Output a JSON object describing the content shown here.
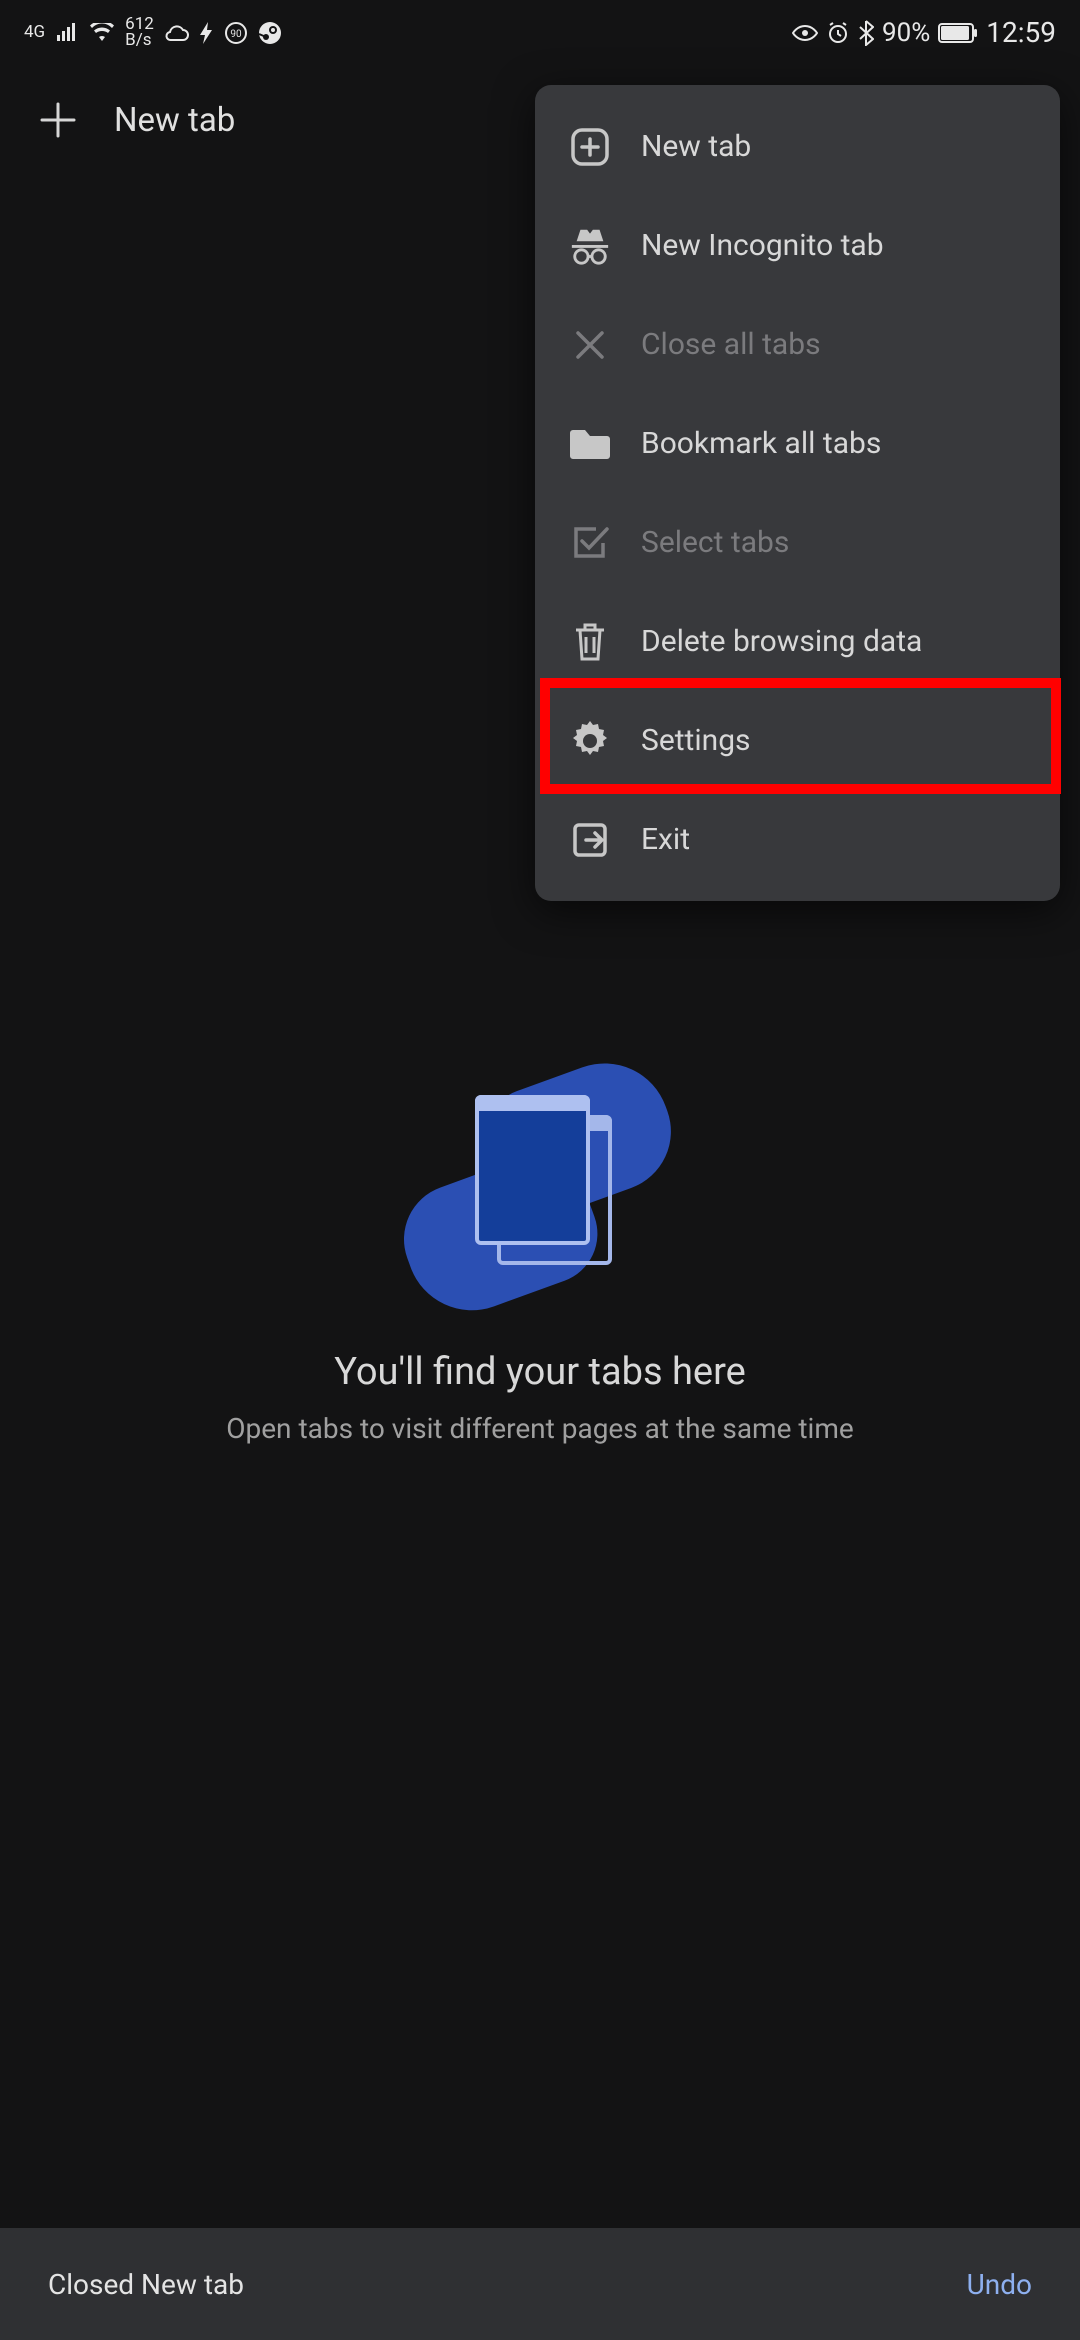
{
  "status_bar": {
    "network_label": "4G",
    "rate_value": "612",
    "rate_unit": "B/s",
    "battery_percent": "90%",
    "time": "12:59"
  },
  "toolbar": {
    "title": "New tab"
  },
  "menu": {
    "items": [
      {
        "label": "New tab",
        "icon": "plus-box",
        "enabled": true
      },
      {
        "label": "New Incognito tab",
        "icon": "incognito",
        "enabled": true
      },
      {
        "label": "Close all tabs",
        "icon": "close",
        "enabled": false
      },
      {
        "label": "Bookmark all tabs",
        "icon": "folder",
        "enabled": true
      },
      {
        "label": "Select tabs",
        "icon": "check-square",
        "enabled": false
      },
      {
        "label": "Delete browsing data",
        "icon": "trash",
        "enabled": true
      },
      {
        "label": "Settings",
        "icon": "gear",
        "enabled": true
      },
      {
        "label": "Exit",
        "icon": "exit",
        "enabled": true
      }
    ],
    "highlighted_index": 6
  },
  "empty_state": {
    "title": "You'll find your tabs here",
    "subtitle": "Open tabs to visit different pages at the same time"
  },
  "snackbar": {
    "message": "Closed New tab",
    "action": "Undo"
  }
}
